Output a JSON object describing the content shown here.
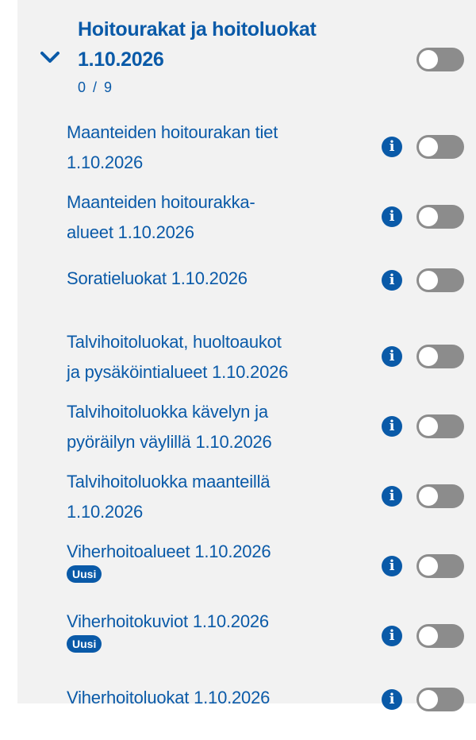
{
  "group": {
    "title_line1": "Hoitourakat ja hoitoluokat",
    "title_line2": "1.10.2026",
    "count": "0 / 9",
    "toggle_on": false
  },
  "layers": [
    {
      "lines": [
        "Maanteiden hoitourakan tiet",
        "1.10.2026"
      ],
      "badge": "",
      "toggle_on": false
    },
    {
      "lines": [
        "Maanteiden hoitourakka-",
        "alueet 1.10.2026"
      ],
      "badge": "",
      "toggle_on": false
    },
    {
      "lines": [
        "Soratieluokat 1.10.2026"
      ],
      "badge": "",
      "toggle_on": false
    },
    {
      "lines": [
        "Talvihoitoluokat, huoltoaukot",
        "ja pysäköintialueet 1.10.2026"
      ],
      "badge": "",
      "toggle_on": false
    },
    {
      "lines": [
        "Talvihoitoluokka kävelyn ja",
        "pyöräilyn väylillä 1.10.2026"
      ],
      "badge": "",
      "toggle_on": false
    },
    {
      "lines": [
        "Talvihoitoluokka maanteillä",
        "1.10.2026"
      ],
      "badge": "",
      "toggle_on": false
    },
    {
      "lines": [
        "Viherhoitoalueet 1.10.2026"
      ],
      "badge": "Uusi",
      "toggle_on": false
    },
    {
      "lines": [
        "Viherhoitokuviot 1.10.2026"
      ],
      "badge": "Uusi",
      "toggle_on": false
    },
    {
      "lines": [
        "Viherhoitoluokat 1.10.2026"
      ],
      "badge": "",
      "toggle_on": false
    }
  ],
  "info_icon_glyph": "i",
  "icons": {
    "expand": "chevron-down-icon",
    "info": "info-icon"
  },
  "colors": {
    "accent": "#0a5aa8",
    "toggle_off": "#8c8c8c",
    "panel_bg": "#f2f2f2"
  }
}
